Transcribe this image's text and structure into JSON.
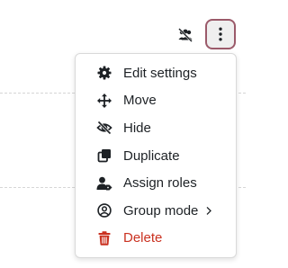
{
  "header": {
    "groups_icon": "groups-off-icon",
    "more_icon": "kebab-vertical-icon",
    "more_button_border_color": "#9b5a6a"
  },
  "menu": {
    "items": [
      {
        "label": "Edit settings",
        "icon": "gear-icon"
      },
      {
        "label": "Move",
        "icon": "move-arrows-icon"
      },
      {
        "label": "Hide",
        "icon": "eye-slash-icon"
      },
      {
        "label": "Duplicate",
        "icon": "copy-icon"
      },
      {
        "label": "Assign roles",
        "icon": "user-tag-icon"
      },
      {
        "label": "Group mode",
        "icon": "user-circle-icon",
        "has_submenu": true
      },
      {
        "label": "Delete",
        "icon": "trash-icon",
        "color": "#ca3120"
      }
    ]
  }
}
